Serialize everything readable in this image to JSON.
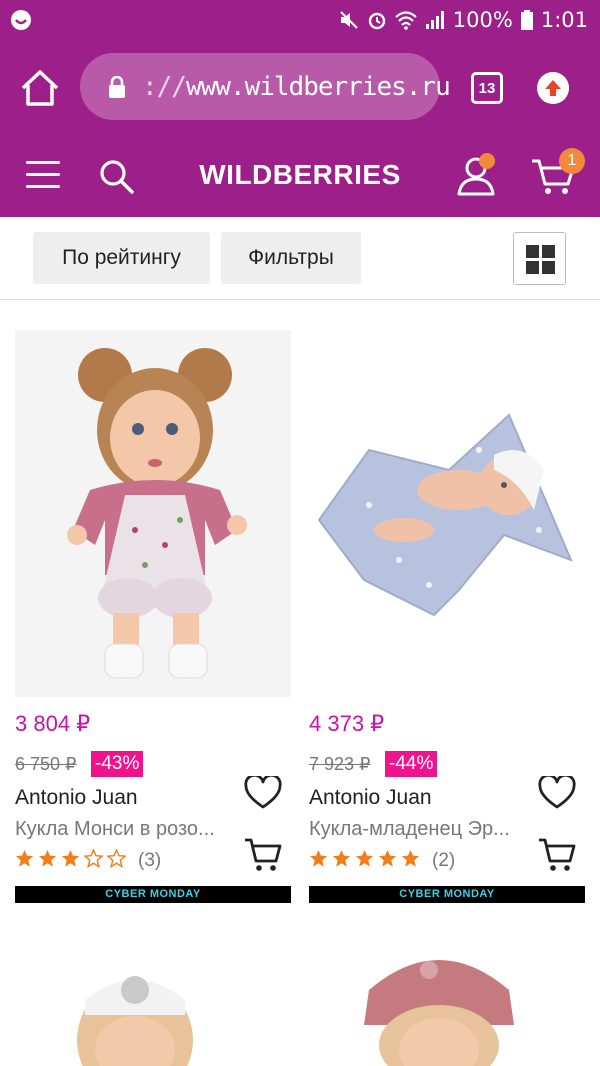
{
  "status_bar": {
    "battery": "100%",
    "time": "1:01"
  },
  "browser": {
    "url_prefix": "://",
    "url_host": "www.wildberries.ru",
    "tabs_count": "13"
  },
  "header": {
    "brand": "WILDBERRIES",
    "cart_count": "1"
  },
  "controls": {
    "sort_label": "По рейтингу",
    "filter_label": "Фильтры"
  },
  "products": [
    {
      "price": "3 804 ₽",
      "old_price": "6 750 ₽",
      "discount": "-43%",
      "brand": "Antonio Juan",
      "name": "Кукла Монси в розо...",
      "rating": 3,
      "reviews": "(3)",
      "promo": "CYBER MONDAY"
    },
    {
      "price": "4 373 ₽",
      "old_price": "7 923 ₽",
      "discount": "-44%",
      "brand": "Antonio Juan",
      "name": "Кукла-младенец Эр...",
      "rating": 5,
      "reviews": "(2)",
      "promo": "CYBER MONDAY"
    }
  ],
  "colors": {
    "brand_purple": "#9d1f8a",
    "price_pink": "#cb11ab",
    "discount_pink": "#f0138e",
    "star_orange": "#f07e1b",
    "badge_orange": "#f28a3b"
  }
}
